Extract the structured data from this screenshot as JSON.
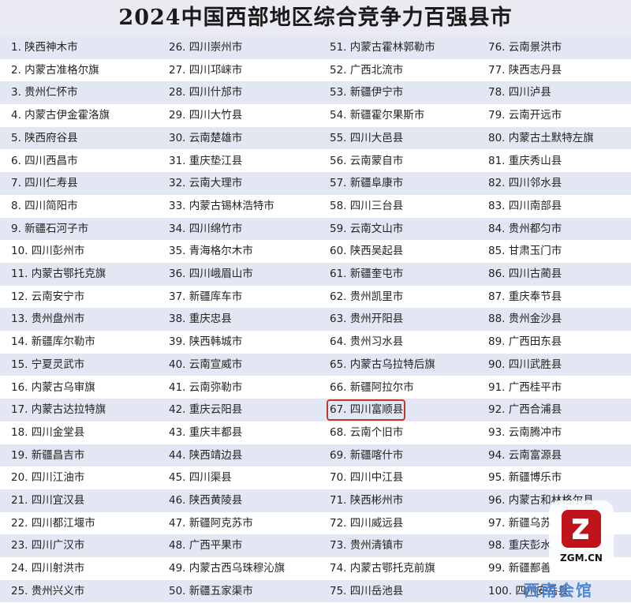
{
  "title": "2024中国西部地区综合竞争力百强县市",
  "columns": [
    [
      "1. 陕西神木市",
      "2. 内蒙古准格尔旗",
      "3. 贵州仁怀市",
      "4. 内蒙古伊金霍洛旗",
      "5. 陕西府谷县",
      "6. 四川西昌市",
      "7. 四川仁寿县",
      "8. 四川简阳市",
      "9. 新疆石河子市",
      "10. 四川彭州市",
      "11. 内蒙古鄂托克旗",
      "12. 云南安宁市",
      "13. 贵州盘州市",
      "14. 新疆库尔勒市",
      "15. 宁夏灵武市",
      "16. 内蒙古乌审旗",
      "17. 内蒙古达拉特旗",
      "18. 四川金堂县",
      "19. 新疆昌吉市",
      "20. 四川江油市",
      "21. 四川宜汉县",
      "22. 四川都江堰市",
      "23. 四川广汉市",
      "24. 四川射洪市",
      "25. 贵州兴义市"
    ],
    [
      "26. 四川崇州市",
      "27. 四川邛崃市",
      "28. 四川什邡市",
      "29. 四川大竹县",
      "30. 云南楚雄市",
      "31. 重庆垫江县",
      "32. 云南大理市",
      "33. 内蒙古锡林浩特市",
      "34. 四川绵竹市",
      "35. 青海格尔木市",
      "36. 四川峨眉山市",
      "37. 新疆库车市",
      "38. 重庆忠县",
      "39. 陕西韩城市",
      "40. 云南宣威市",
      "41. 云南弥勒市",
      "42. 重庆云阳县",
      "43. 重庆丰都县",
      "44. 陕西靖边县",
      "45. 四川渠县",
      "46. 陕西黄陵县",
      "47. 新疆阿克苏市",
      "48. 广西平果市",
      "49. 内蒙古西乌珠穆沁旗",
      "50. 新疆五家渠市"
    ],
    [
      "51. 内蒙古霍林郭勒市",
      "52. 广西北流市",
      "53. 新疆伊宁市",
      "54. 新疆霍尔果斯市",
      "55. 四川大邑县",
      "56. 云南蒙自市",
      "57. 新疆阜康市",
      "58. 四川三台县",
      "59. 云南文山市",
      "60. 陕西吴起县",
      "61. 新疆奎屯市",
      "62. 贵州凯里市",
      "63. 贵州开阳县",
      "64. 贵州习水县",
      "65. 内蒙古乌拉特后旗",
      "66. 新疆阿拉尔市",
      "67. 四川富顺县",
      "68. 云南个旧市",
      "69. 新疆喀什市",
      "70. 四川中江县",
      "71. 陕西彬州市",
      "72. 四川威远县",
      "73. 贵州清镇市",
      "74. 内蒙古鄂托克前旗",
      "75. 四川岳池县"
    ],
    [
      "76. 云南景洪市",
      "77. 陕西志丹县",
      "78. 四川泸县",
      "79. 云南开远市",
      "80. 内蒙古土默特左旗",
      "81. 重庆秀山县",
      "82. 四川邻水县",
      "83. 四川南部县",
      "84. 贵州都匀市",
      "85. 甘肃玉门市",
      "86. 四川古蔺县",
      "87. 重庆奉节县",
      "88. 贵州金沙县",
      "89. 广西田东县",
      "90. 四川武胜县",
      "91. 广西桂平市",
      "92. 广西合浦县",
      "93. 云南腾冲市",
      "94. 云南富源县",
      "95. 新疆博乐市",
      "96. 内蒙古和林格尔县",
      "97. 新疆乌苏",
      "98. 重庆彭水",
      "99. 新疆鄯善",
      "100. 四川安岳县"
    ]
  ],
  "logo": {
    "text": "ZGM.CN"
  },
  "watermark": "西南会馆",
  "colors": {
    "row_stripe": "#e3e6f3",
    "highlight": "#c0392b",
    "logo": "#c0141b"
  }
}
